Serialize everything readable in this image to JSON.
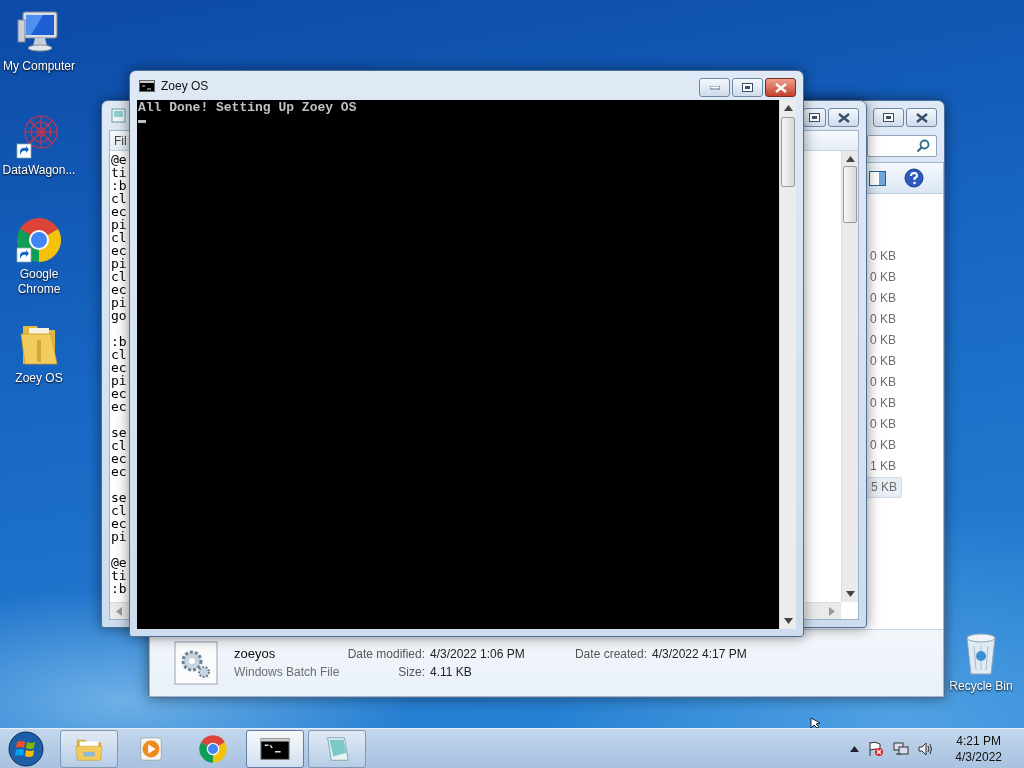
{
  "desktop": {
    "icons": [
      {
        "label": "My Computer",
        "kind": "computer",
        "shortcut": false
      },
      {
        "label": "DataWagon...",
        "kind": "web",
        "shortcut": true
      },
      {
        "label": "Google Chrome",
        "kind": "chrome",
        "shortcut": true
      },
      {
        "label": "Zoey OS",
        "kind": "folder",
        "shortcut": false
      }
    ],
    "recycle_bin": {
      "label": "Recycle Bin",
      "kind": "recycle",
      "shortcut": false
    }
  },
  "explorer": {
    "active": false,
    "sizes": [
      {
        "text": "0 KB",
        "selected": false
      },
      {
        "text": "0 KB",
        "selected": false
      },
      {
        "text": "0 KB",
        "selected": false
      },
      {
        "text": "0 KB",
        "selected": false
      },
      {
        "text": "0 KB",
        "selected": false
      },
      {
        "text": "0 KB",
        "selected": false
      },
      {
        "text": "0 KB",
        "selected": false
      },
      {
        "text": "0 KB",
        "selected": false
      },
      {
        "text": "0 KB",
        "selected": false
      },
      {
        "text": "0 KB",
        "selected": false
      },
      {
        "text": "1 KB",
        "selected": false
      },
      {
        "text": "5 KB",
        "selected": true
      }
    ],
    "details": {
      "name": "zoeyos",
      "type": "Windows Batch File",
      "modified": {
        "label": "Date modified:",
        "value": "4/3/2022 1:06 PM"
      },
      "size": {
        "label": "Size:",
        "value": "4.11 KB"
      },
      "created": {
        "label": "Date created:",
        "value": "4/3/2022 4:17 PM"
      }
    }
  },
  "notepad": {
    "active": false,
    "menu": "Fil",
    "blocks": [
      [
        "@e",
        "ti",
        ":b",
        "cl",
        "ec",
        "pi",
        "cl",
        "ec",
        "pi",
        "cl",
        "ec",
        "pi",
        "go"
      ],
      [
        ":b",
        "cl",
        "ec",
        "pi",
        "ec",
        "ec"
      ],
      [
        "se",
        "cl",
        "ec",
        "ec"
      ],
      [
        "se",
        "cl",
        "ec",
        "pi"
      ],
      [
        "@e",
        "ti",
        ":b"
      ]
    ]
  },
  "console": {
    "active": true,
    "title": "Zoey OS",
    "lines": [
      "All Done! Setting Up Zoey OS"
    ],
    "cursor": true
  },
  "taskbar": {
    "buttons": [
      {
        "kind": "explorer",
        "running": true,
        "selected": false
      },
      {
        "kind": "media",
        "running": false,
        "selected": false
      },
      {
        "kind": "chrome",
        "running": false,
        "selected": false
      },
      {
        "kind": "console",
        "running": true,
        "selected": true
      },
      {
        "kind": "notepad",
        "running": true,
        "selected": false
      }
    ],
    "time": "4:21 PM",
    "date": "4/3/2022"
  }
}
